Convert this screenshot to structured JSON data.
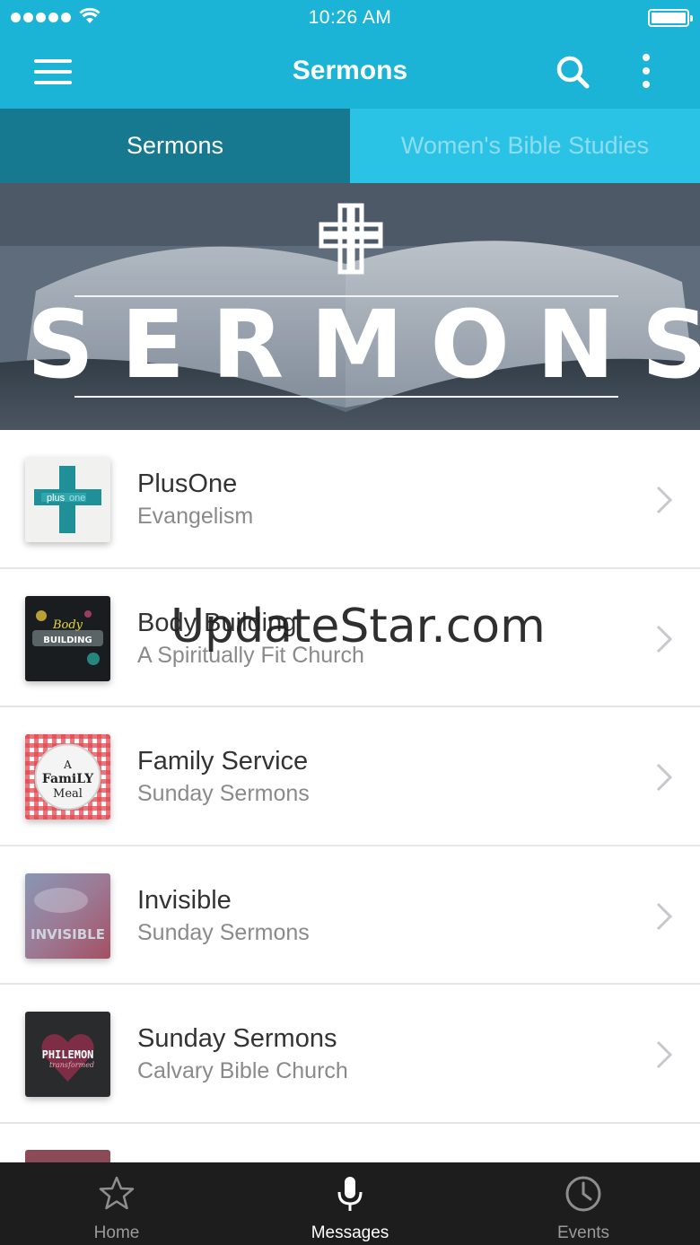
{
  "status_bar": {
    "time": "10:26 AM"
  },
  "nav": {
    "title": "Sermons",
    "menu_icon": "hamburger-icon",
    "search_icon": "search-icon",
    "more_icon": "more-vertical-icon"
  },
  "tabs": [
    {
      "label": "Sermons",
      "active": true
    },
    {
      "label": "Women's Bible Studies",
      "active": false
    }
  ],
  "hero": {
    "title": "SERMONS",
    "icon": "cross-icon"
  },
  "list": {
    "items": [
      {
        "title": "PlusOne",
        "subtitle": "Evangelism",
        "thumb_text": "plus one"
      },
      {
        "title": "Body Building",
        "subtitle": "A Spiritually Fit Church",
        "thumb_text": "Body BUILDING"
      },
      {
        "title": "Family Service",
        "subtitle": "Sunday Sermons",
        "thumb_text": "A Family Meal"
      },
      {
        "title": "Invisible",
        "subtitle": "Sunday Sermons",
        "thumb_text": "INVISIBLE"
      },
      {
        "title": "Sunday Sermons",
        "subtitle": "Calvary Bible Church",
        "thumb_text": "PHILEMON"
      }
    ]
  },
  "watermark": "UpdateStar.com",
  "tab_bar": {
    "items": [
      {
        "label": "Home",
        "icon": "star-icon",
        "active": false
      },
      {
        "label": "Messages",
        "icon": "microphone-icon",
        "active": true
      },
      {
        "label": "Events",
        "icon": "clock-icon",
        "active": false
      }
    ]
  },
  "colors": {
    "brand": "#1bb4d6",
    "tab_active": "#17798f",
    "tab_inactive": "#2ac3e5",
    "tab_bar": "#1d1d1d"
  }
}
